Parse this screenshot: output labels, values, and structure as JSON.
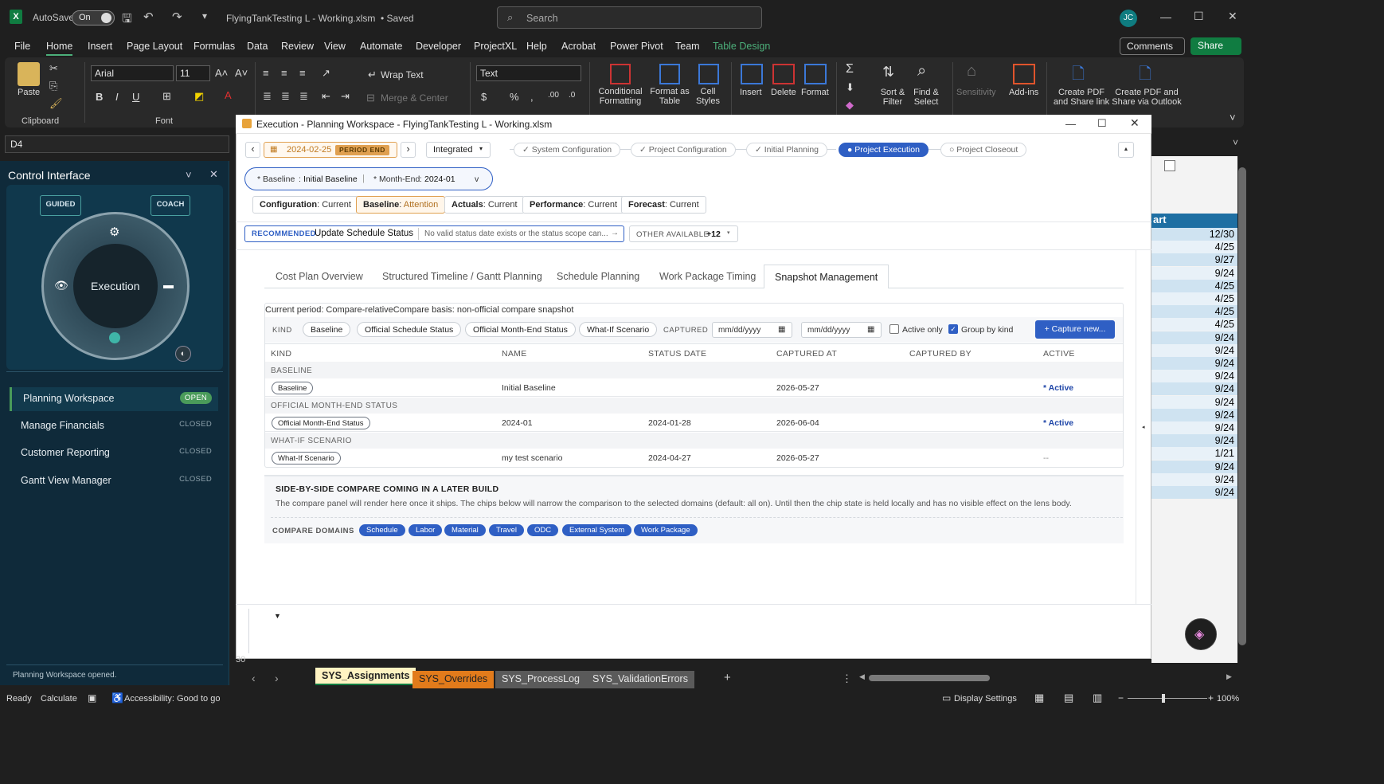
{
  "titlebar": {
    "autosave_label": "AutoSave",
    "autosave_state": "On",
    "file_name": "FlyingTankTesting L - Working.xlsm",
    "saved_status": "• Saved",
    "search_placeholder": "Search",
    "user_initials": "JC"
  },
  "menu": {
    "items": [
      "File",
      "Home",
      "Insert",
      "Page Layout",
      "Formulas",
      "Data",
      "Review",
      "View",
      "Automate",
      "Developer",
      "ProjectXL",
      "Help",
      "Acrobat",
      "Power Pivot",
      "Team",
      "Table Design"
    ],
    "active": "Home",
    "comments": "Comments",
    "share": "Share"
  },
  "ribbon": {
    "paste": "Paste",
    "clipboard": "Clipboard",
    "font_name": "Arial",
    "font_size": "11",
    "font_group": "Font",
    "wrap_text": "Wrap Text",
    "merge_center": "Merge & Center",
    "number_format": "Text",
    "conditional_formatting": "Conditional Formatting",
    "format_as_table": "Format as Table",
    "cell_styles": "Cell Styles",
    "insert": "Insert",
    "delete": "Delete",
    "format": "Format",
    "sort_filter": "Sort & Filter",
    "find_select": "Find & Select",
    "sensitivity": "Sensitivity",
    "addins": "Add-ins",
    "create_pdf_link": "Create PDF and Share link",
    "create_pdf_outlook": "Create PDF and Share via Outlook",
    "table_design_color": "#4caf7a"
  },
  "formula_bar": {
    "name_box": "D4"
  },
  "control_panel": {
    "title": "Control Interface",
    "guided": "GUIDED",
    "coach": "COACH",
    "dial_label": "Execution",
    "items": [
      {
        "label": "Planning Workspace",
        "status": "OPEN"
      },
      {
        "label": "Manage Financials",
        "status": "CLOSED"
      },
      {
        "label": "Customer Reporting",
        "status": "CLOSED"
      },
      {
        "label": "Gantt View Manager",
        "status": "CLOSED"
      }
    ],
    "footer": "Planning Workspace opened."
  },
  "workspace": {
    "window_title": "Execution - Planning Workspace - FlyingTankTesting L - Working.xlsm",
    "period_date": "2024-02-25",
    "period_tag": "PERIOD END",
    "view_mode": "Integrated",
    "steps": [
      {
        "label": "✓ System Configuration",
        "state": "done"
      },
      {
        "label": "✓ Project Configuration",
        "state": "done"
      },
      {
        "label": "✓ Initial Planning",
        "state": "done"
      },
      {
        "label": "● Project Execution",
        "state": "active"
      },
      {
        "label": "○ Project Closeout",
        "state": "todo"
      }
    ],
    "baseline_selector": {
      "baseline_key": "* Baseline",
      "baseline_value": "Initial Baseline",
      "month_key": "* Month-End",
      "month_value": "2024-01",
      "caret": "v"
    },
    "status_chips": [
      {
        "key": "Configuration",
        "value": "Current"
      },
      {
        "key": "Baseline",
        "value": "Attention"
      },
      {
        "key": "Actuals",
        "value": "Current"
      },
      {
        "key": "Performance",
        "value": "Current"
      },
      {
        "key": "Forecast",
        "value": "Current"
      }
    ],
    "recommended": {
      "tag": "RECOMMENDED",
      "title": "Update Schedule Status",
      "detail": "No valid status date exists or the status scope can...",
      "arrow": "→"
    },
    "other_available": {
      "label": "OTHER AVAILABLE",
      "count": "+12"
    },
    "tabs": [
      "Cost Plan Overview",
      "Structured Timeline / Gantt Planning",
      "Schedule Planning",
      "Work Package Timing",
      "Snapshot Management"
    ],
    "active_tab": "Snapshot Management",
    "snapshot": {
      "period_text": "Current period: Compare-relativeCompare basis: non-official compare snapshot",
      "kind_label": "KIND",
      "kind_filters": [
        "Baseline",
        "Official Schedule Status",
        "Official Month-End Status",
        "What-If Scenario"
      ],
      "captured_label": "CAPTURED",
      "date_from_placeholder": "mm/dd/yyyy",
      "date_to_placeholder": "mm/dd/yyyy",
      "active_only": "Active only",
      "group_by_kind": "Group by kind",
      "capture_button": "+ Capture new...",
      "columns": [
        "KIND",
        "NAME",
        "STATUS DATE",
        "CAPTURED AT",
        "CAPTURED BY",
        "ACTIVE"
      ],
      "groups": [
        {
          "group": "BASELINE",
          "kind": "Baseline",
          "name": "Initial Baseline",
          "status_date": "",
          "captured_at": "2026-05-27",
          "captured_by": "",
          "active": "* Active"
        },
        {
          "group": "OFFICIAL MONTH-END STATUS",
          "kind": "Official Month-End Status",
          "name": "2024-01",
          "status_date": "2024-01-28",
          "captured_at": "2026-06-04",
          "captured_by": "",
          "active": "* Active"
        },
        {
          "group": "WHAT-IF SCENARIO",
          "kind": "What-If Scenario",
          "name": "my test scenario",
          "status_date": "2024-04-27",
          "captured_at": "2026-05-27",
          "captured_by": "",
          "active": "--"
        }
      ],
      "compare_title": "SIDE-BY-SIDE COMPARE COMING IN A LATER BUILD",
      "compare_text": "The compare panel will render here once it ships. The chips below will narrow the comparison to the selected domains (default: all on). Until then the chip state is held locally and has no visible effect on the lens body.",
      "compare_domains_label": "COMPARE DOMAINS",
      "compare_domains": [
        "Schedule",
        "Labor",
        "Material",
        "Travel",
        "ODC",
        "External System",
        "Work Package"
      ]
    },
    "bottom_dropdown": "▼"
  },
  "sheet": {
    "header_fragment": "art",
    "cells": [
      "12/30",
      "4/25",
      "9/27",
      "9/24",
      "4/25",
      "4/25",
      "4/25",
      "4/25",
      "9/24",
      "9/24",
      "9/24",
      "9/24",
      "9/24",
      "9/24",
      "9/24",
      "9/24",
      "9/24",
      "1/21",
      "9/24",
      "9/24",
      "9/24"
    ],
    "row_number": "30",
    "tabs": [
      {
        "label": "SYS_Assignments",
        "style": "active"
      },
      {
        "label": "SYS_Overrides",
        "style": "orange"
      },
      {
        "label": "SYS_ProcessLog",
        "style": "gray"
      },
      {
        "label": "SYS_ValidationErrors",
        "style": "gray"
      }
    ]
  },
  "statusbar": {
    "ready": "Ready",
    "calculate": "Calculate",
    "accessibility": "Accessibility: Good to go",
    "display_settings": "Display Settings",
    "zoom": "100%"
  }
}
